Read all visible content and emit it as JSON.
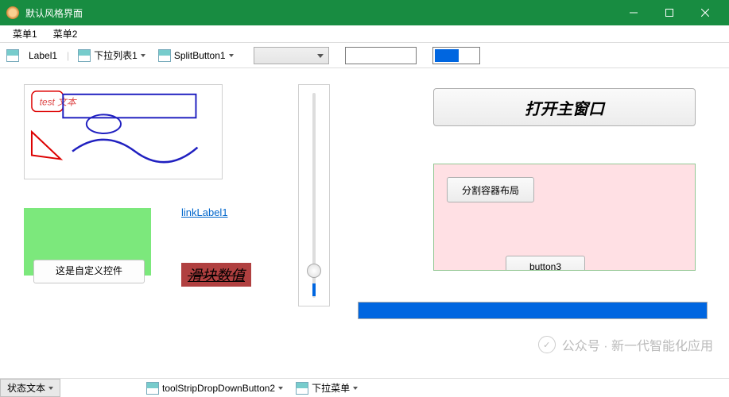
{
  "window": {
    "title": "默认风格界面"
  },
  "menubar": {
    "items": [
      "菜单1",
      "菜单2"
    ]
  },
  "toolbar": {
    "label1": "Label1",
    "dropdown1": "下拉列表1",
    "splitbutton1": "SplitButton1",
    "color": "#0066e0"
  },
  "panel": {
    "drawing_text": "test 文本"
  },
  "linklabel": "linkLabel1",
  "custom_control_label": "这是自定义控件",
  "slider_label": "滑块数值",
  "main_button": "打开主窗口",
  "split_container": {
    "button1_label": "分割容器布局",
    "button2_label": "button3"
  },
  "progress": {
    "value": 100
  },
  "statusbar": {
    "status_text": "状态文本",
    "dropdown_button": "toolStripDropDownButton2",
    "dropdown_menu": "下拉菜单"
  },
  "watermark": "公众号 · 新一代智能化应用"
}
